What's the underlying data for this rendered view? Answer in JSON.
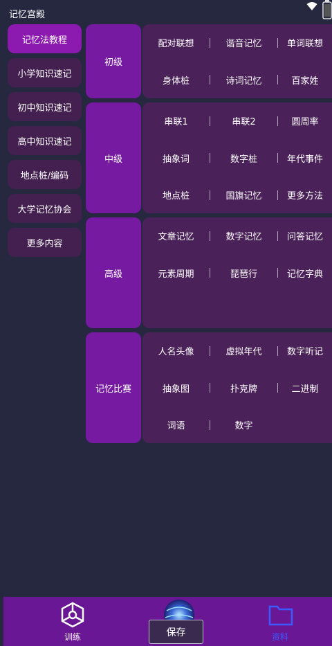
{
  "app": {
    "title": "记忆宫殿"
  },
  "sidebar": {
    "items": [
      {
        "label": "记忆法教程",
        "active": true
      },
      {
        "label": "小学知识速记"
      },
      {
        "label": "初中知识速记"
      },
      {
        "label": "高中知识速记"
      },
      {
        "label": "地点桩/编码"
      },
      {
        "label": "大学记忆协会"
      },
      {
        "label": "更多内容"
      }
    ]
  },
  "sections": [
    {
      "level": "初级",
      "rows": [
        [
          "配对联想",
          "谐音记忆",
          "单词联想"
        ],
        [
          "身体桩",
          "诗词记忆",
          "百家姓"
        ]
      ]
    },
    {
      "level": "中级",
      "rows": [
        [
          "串联1",
          "串联2",
          "圆周率"
        ],
        [
          "抽象词",
          "数字桩",
          "年代事件"
        ],
        [
          "地点桩",
          "国旗记忆",
          "更多方法"
        ]
      ]
    },
    {
      "level": "高级",
      "rows": [
        [
          "文章记忆",
          "数字记忆",
          "问答记忆"
        ],
        [
          "元素周期",
          "琵琶行",
          "记忆字典"
        ]
      ]
    },
    {
      "level": "记忆比赛",
      "rows": [
        [
          "人名头像",
          "虚拟年代",
          "数字听记"
        ],
        [
          "抽象图",
          "扑克牌",
          "二进制"
        ],
        [
          "词语",
          "数字"
        ]
      ]
    }
  ],
  "tabbar": {
    "train_label": "训练",
    "save_label": "保存",
    "data_label": "资料",
    "active_color": "#3a5bff"
  },
  "colors": {
    "background": "#262840",
    "panel": "#4a2158",
    "level": "#751aa1",
    "active": "#8d1ab0"
  }
}
